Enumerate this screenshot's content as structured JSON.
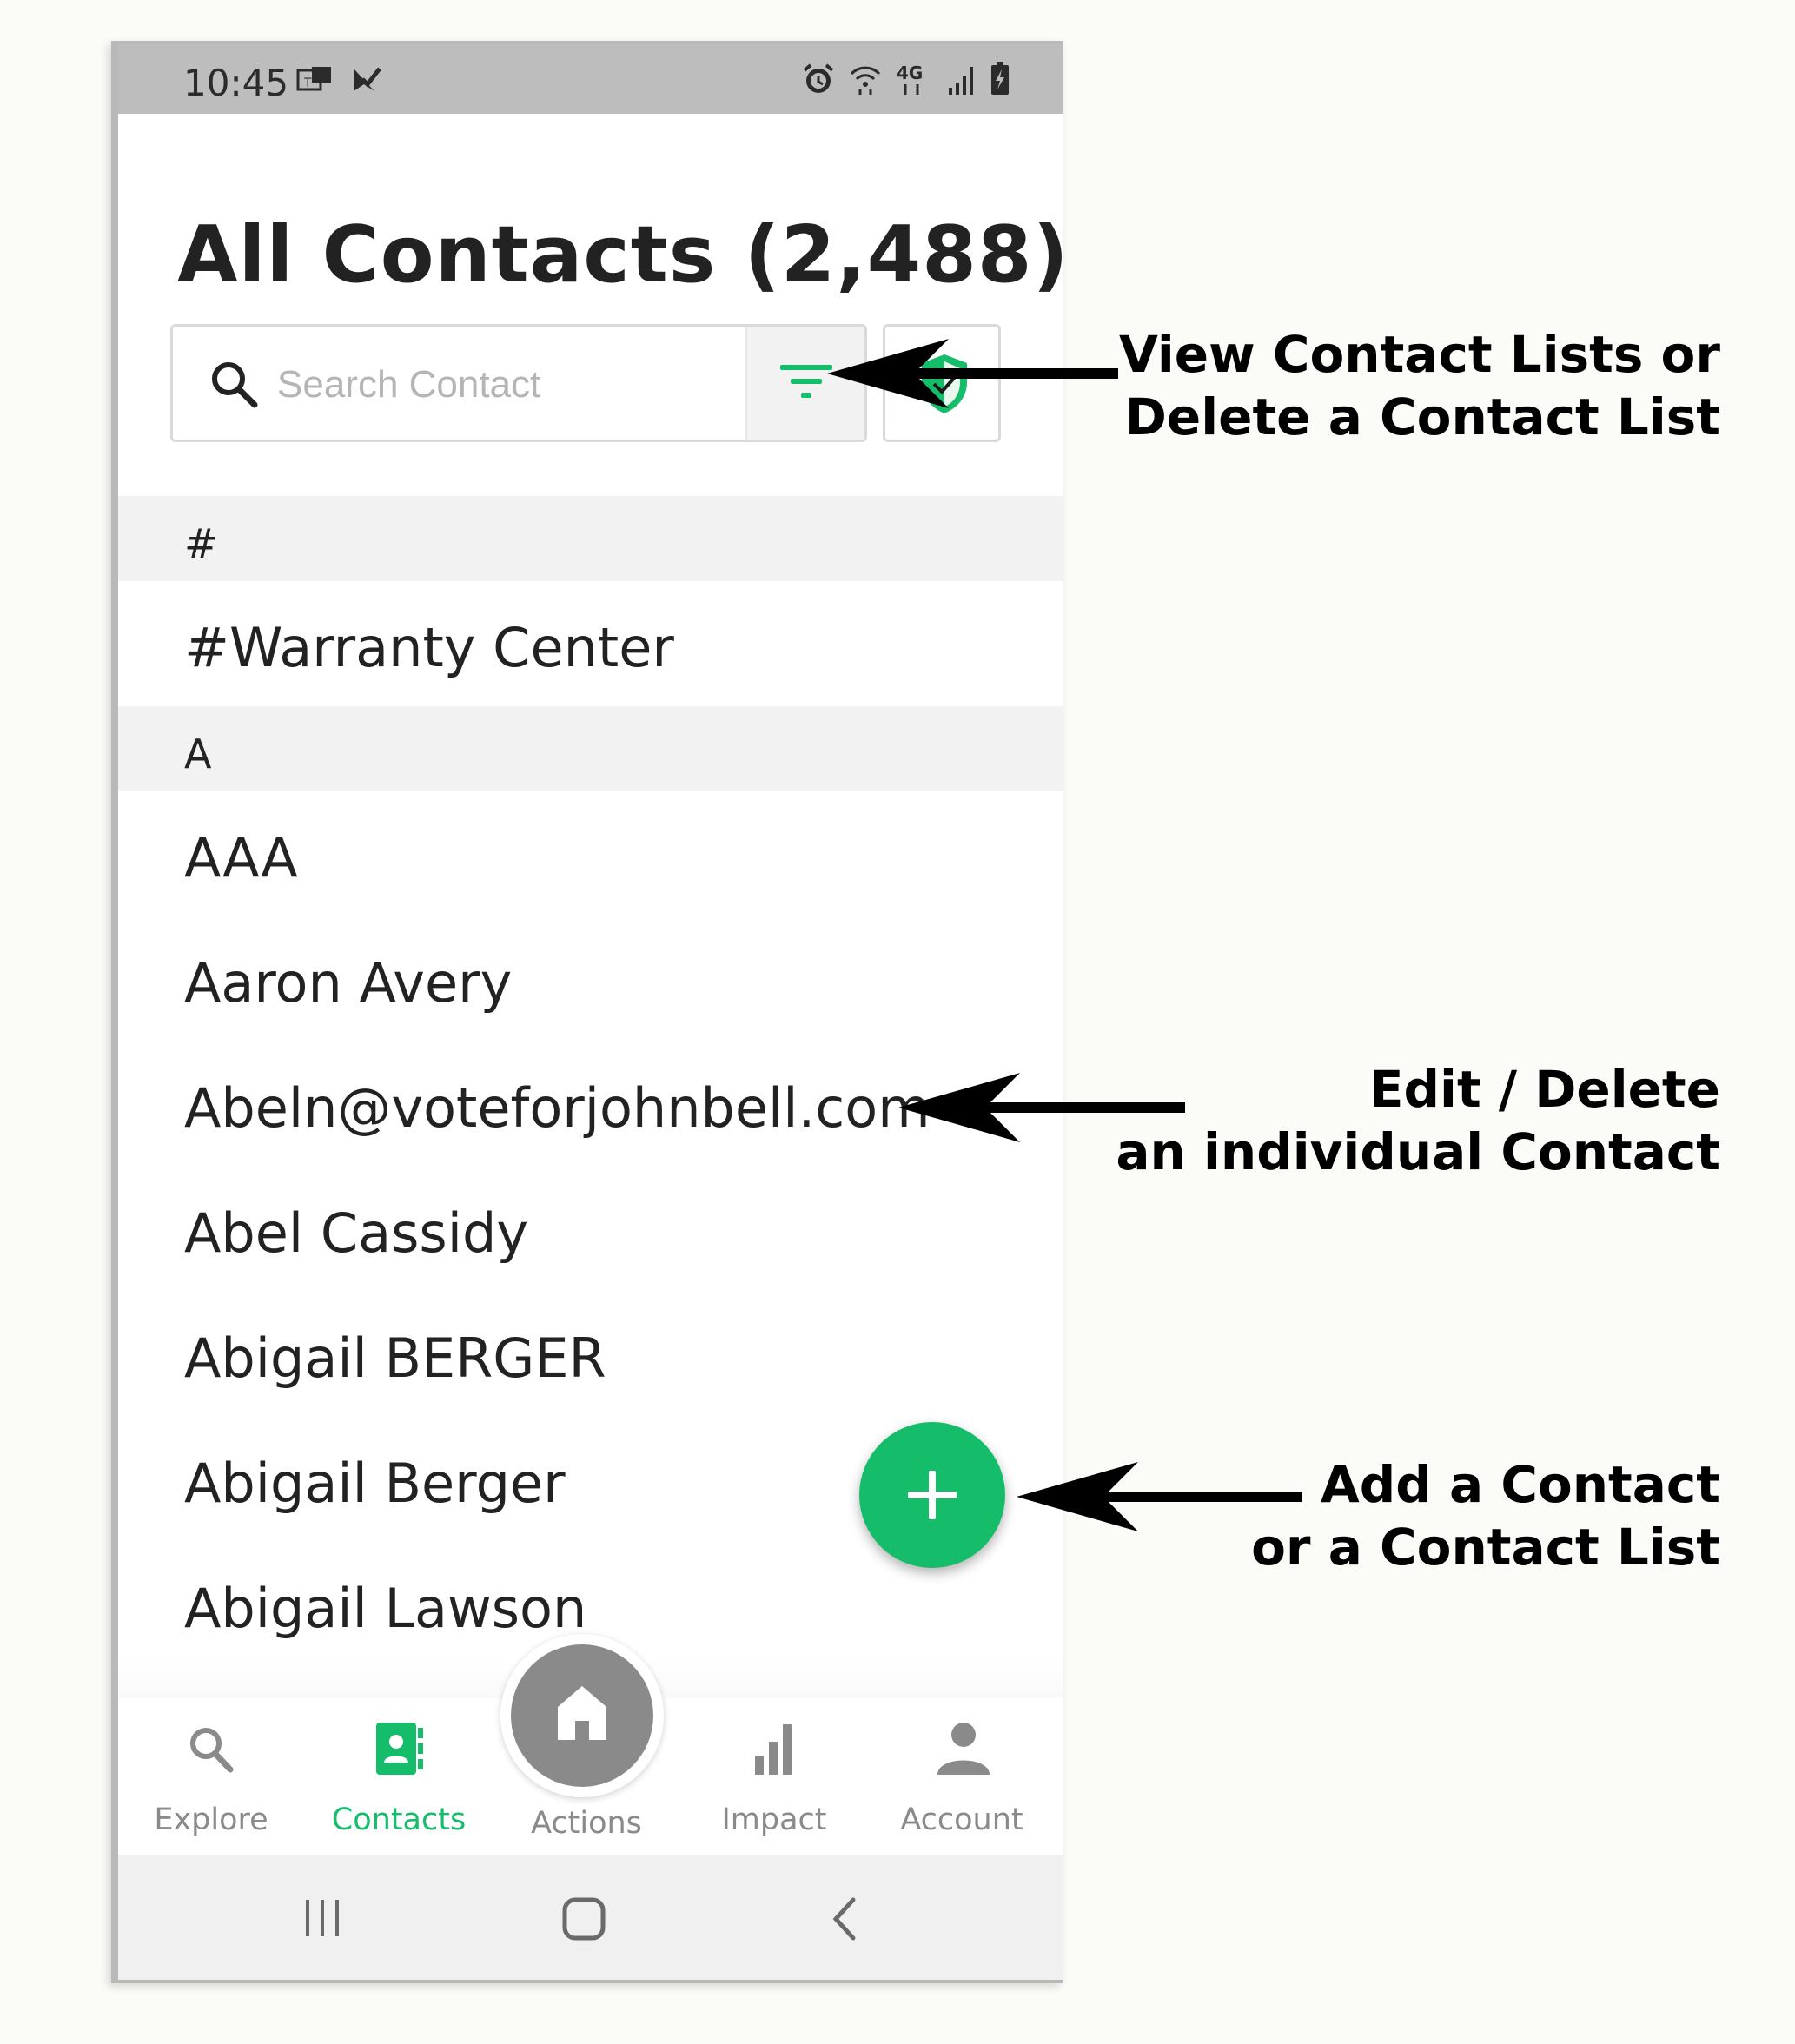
{
  "status_bar": {
    "time": "10:45"
  },
  "header": {
    "title": "All Contacts (2,488)"
  },
  "search": {
    "placeholder": "Search Contact",
    "value": ""
  },
  "sections": [
    {
      "header": "#",
      "contacts": [
        "#Warranty Center"
      ]
    },
    {
      "header": "A",
      "contacts": [
        "AAA",
        "Aaron Avery",
        "Abeln@voteforjohnbell.com",
        "Abel Cassidy",
        "Abigail BERGER",
        "Abigail Berger",
        "Abigail Lawson"
      ]
    }
  ],
  "bottom_nav": {
    "items": [
      {
        "label": "Explore",
        "icon": "search-icon"
      },
      {
        "label": "Contacts",
        "icon": "contacts-icon",
        "active": true
      },
      {
        "label": "Actions",
        "icon": "home-icon"
      },
      {
        "label": "Impact",
        "icon": "bar-chart-icon"
      },
      {
        "label": "Account",
        "icon": "person-icon"
      }
    ]
  },
  "annotations": {
    "filter": {
      "line1": "View Contact Lists or",
      "line2": "Delete a Contact List"
    },
    "contact": {
      "line1": "Edit / Delete",
      "line2": "an individual Contact"
    },
    "add": {
      "line1": "Add a Contact",
      "line2": "or a Contact List"
    }
  },
  "colors": {
    "accent_green": "#15bd6a",
    "status_bar_bg": "#bdbdbd",
    "section_header_bg": "#f2f2f2",
    "inactive_gray": "#8a8a8a"
  }
}
